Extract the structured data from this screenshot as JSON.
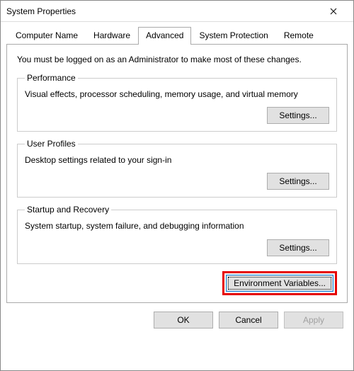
{
  "window": {
    "title": "System Properties"
  },
  "tabs": [
    {
      "label": "Computer Name"
    },
    {
      "label": "Hardware"
    },
    {
      "label": "Advanced"
    },
    {
      "label": "System Protection"
    },
    {
      "label": "Remote"
    }
  ],
  "intro": "You must be logged on as an Administrator to make most of these changes.",
  "sections": {
    "performance": {
      "title": "Performance",
      "desc": "Visual effects, processor scheduling, memory usage, and virtual memory",
      "button": "Settings..."
    },
    "userprofiles": {
      "title": "User Profiles",
      "desc": "Desktop settings related to your sign-in",
      "button": "Settings..."
    },
    "startup": {
      "title": "Startup and Recovery",
      "desc": "System startup, system failure, and debugging information",
      "button": "Settings..."
    }
  },
  "envbutton": "Environment Variables...",
  "footer": {
    "ok": "OK",
    "cancel": "Cancel",
    "apply": "Apply"
  }
}
